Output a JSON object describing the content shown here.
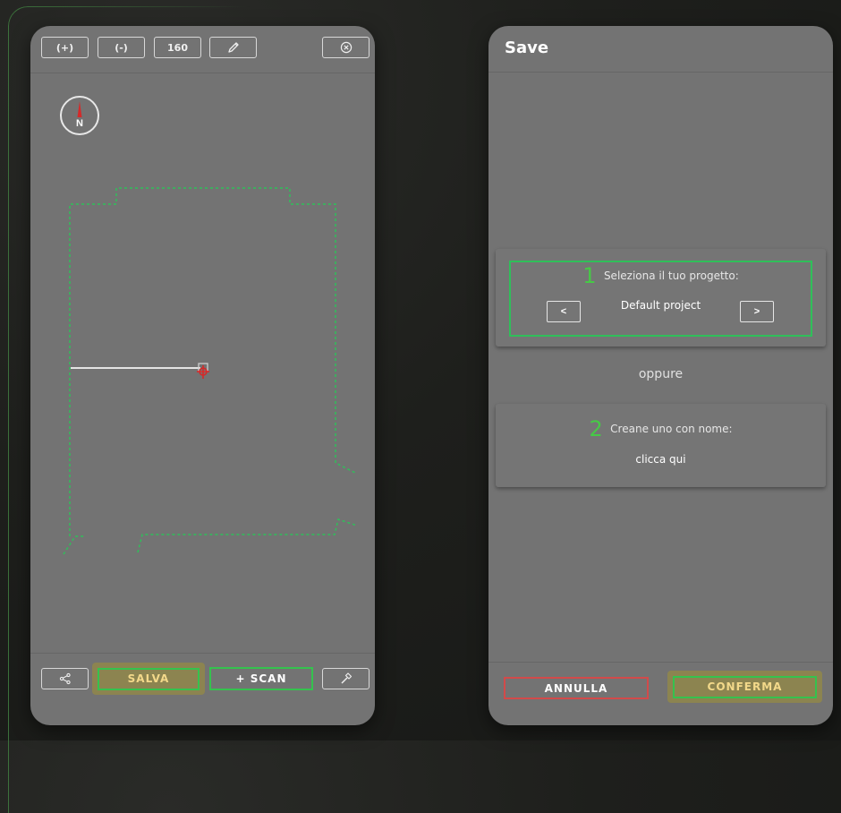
{
  "scan_screen": {
    "toolbar": {
      "zoom_in_label": "(+)",
      "zoom_out_label": "(-)",
      "zoom_value": "160",
      "draw_icon": "pencil-icon",
      "close_icon": "close-circle-icon"
    },
    "compass": {
      "label": "N",
      "needle_color": "#d42a2a"
    },
    "bottom_bar": {
      "share_icon": "share-icon",
      "save_label": "SALVA",
      "scan_label": "+ SCAN",
      "tools_icon": "hammer-icon"
    }
  },
  "save_screen": {
    "title": "Save",
    "step1": {
      "number": "1",
      "label": "Seleziona il tuo progetto:",
      "project_name": "Default project",
      "prev_label": "<",
      "next_label": ">"
    },
    "or_label": "oppure",
    "step2": {
      "number": "2",
      "label": "Creane uno con nome:",
      "action": "clicca qui"
    },
    "footer": {
      "cancel_label": "ANNULLA",
      "confirm_label": "CONFERMA"
    }
  },
  "colors": {
    "screen_bg": "#737373",
    "accent_green": "#2fb84f",
    "cancel_red": "#d24a4a",
    "highlight_olive": "#8c8450",
    "highlight_text": "#f3d98a"
  }
}
